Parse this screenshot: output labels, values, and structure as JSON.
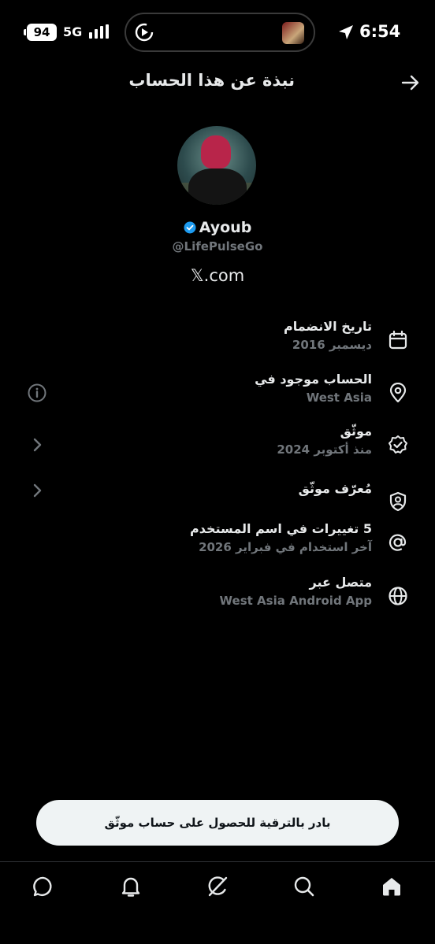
{
  "status_bar": {
    "battery": "94",
    "network": "5G",
    "time": "6:54"
  },
  "header": {
    "title": "نبذة عن هذا الحساب"
  },
  "profile": {
    "name": "Ayoub",
    "handle": "@LifePulseGo",
    "site": "𝕏.com"
  },
  "info_rows": [
    {
      "title": "تاريخ الانضمام",
      "subtitle": "ديسمبر 2016",
      "icon": "calendar-icon"
    },
    {
      "title": "الحساب موجود في",
      "subtitle": "West Asia",
      "icon": "location-pin-icon",
      "left_icon": "info-icon"
    },
    {
      "title": "موثّق",
      "subtitle": "منذ أكتوبر 2024",
      "icon": "verified-badge-icon",
      "left_icon": "chevron-left-icon"
    },
    {
      "title": "مُعرّف موثّق",
      "subtitle": "",
      "icon": "shield-person-icon",
      "left_icon": "chevron-left-icon"
    },
    {
      "title": "5 تغييرات في اسم المستخدم",
      "subtitle": "آخر استخدام في فبراير 2026",
      "icon": "at-sign-icon"
    },
    {
      "title": "متصل عبر",
      "subtitle": "West Asia Android App",
      "icon": "globe-icon"
    }
  ],
  "upgrade_button": {
    "label": "بادر بالترقية للحصول على حساب موثّق"
  },
  "tabs": [
    "messages-icon",
    "notifications-icon",
    "grok-icon",
    "search-icon",
    "home-icon"
  ],
  "colors": {
    "background": "#000000",
    "primary_text": "#e7e9ea",
    "secondary_text": "#71767b",
    "verified_blue": "#1d9bf0",
    "button_bg": "#eff3f4"
  }
}
